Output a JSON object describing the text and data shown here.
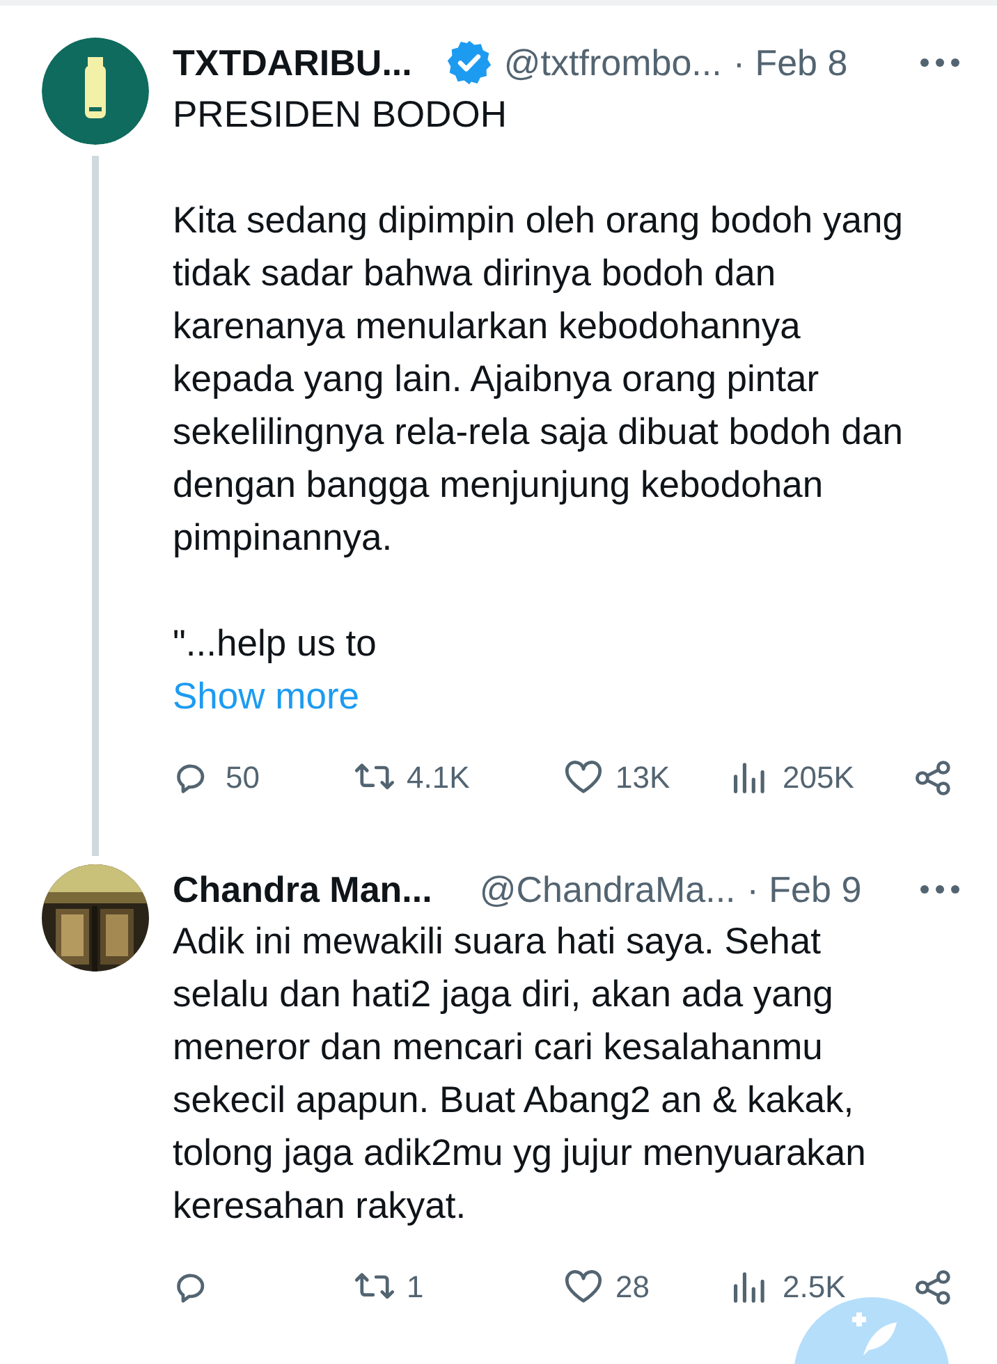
{
  "tweets": [
    {
      "avatar": {
        "kind": "logo"
      },
      "name": "TXTDARIBU...",
      "verified": true,
      "handle": "@txtfrombo...",
      "date": "· Feb 8",
      "thread_line": true,
      "paragraphs": [
        "PRESIDEN BODOH",
        "Kita sedang dipimpin oleh orang bodoh yang tidak sadar bahwa dirinya bodoh dan karenanya menularkan kebodohannya kepada yang lain. Ajaibnya orang pintar sekelilingnya rela-rela saja dibuat bodoh dan dengan bangga menjunjung kebodohan pimpinannya.",
        "\"...help us to"
      ],
      "show_more": "Show more",
      "actions": [
        {
          "kind": "reply",
          "count": "50"
        },
        {
          "kind": "retweet",
          "count": "4.1K"
        },
        {
          "kind": "like",
          "count": "13K"
        },
        {
          "kind": "views",
          "count": "205K"
        },
        {
          "kind": "share"
        }
      ]
    },
    {
      "avatar": {
        "kind": "picture"
      },
      "name": "Chandra Man...",
      "verified": false,
      "handle": "@ChandraMa...",
      "date": "· Feb 9",
      "thread_line": false,
      "paragraphs": [
        "Adik ini mewakili suara hati saya. Sehat selalu dan hati2 jaga diri, akan ada yang meneror dan mencari cari kesalahanmu sekecil apapun. Buat Abang2 an & kakak, tolong jaga adik2mu yg jujur menyuarakan keresahan rakyat."
      ],
      "actions": [
        {
          "kind": "reply"
        },
        {
          "kind": "retweet",
          "count": "1"
        },
        {
          "kind": "like",
          "count": "28"
        },
        {
          "kind": "views",
          "count": "2.5K"
        },
        {
          "kind": "share"
        }
      ]
    }
  ]
}
